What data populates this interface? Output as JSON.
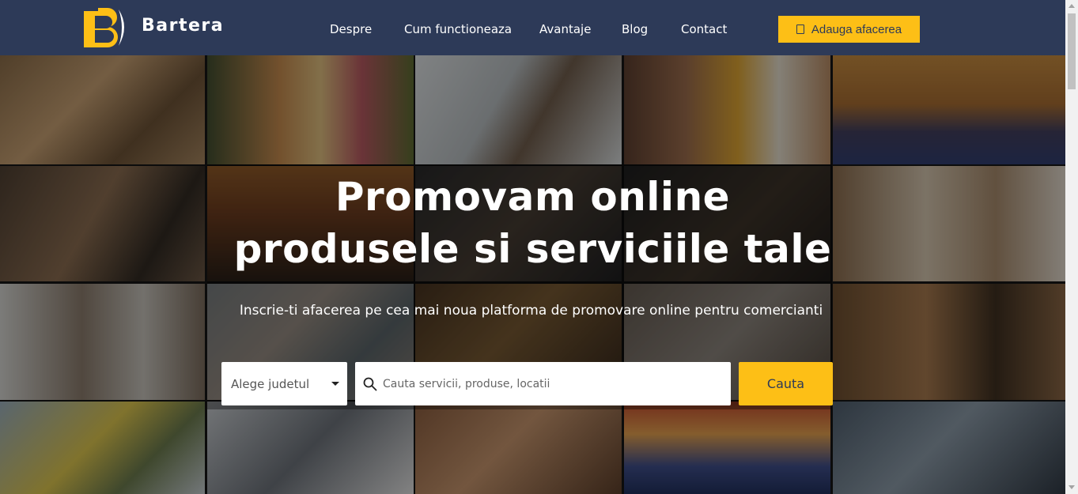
{
  "header": {
    "brand": "Bartera",
    "nav": [
      "Despre",
      "Cum functioneaza",
      "Avantaje",
      "Blog",
      "Contact"
    ],
    "add_business_label": "Adauga afacerea"
  },
  "hero": {
    "headline_line1": "Promovam online",
    "headline_line2": "produsele si serviciile tale",
    "subtitle": "Inscrie-ti afacerea pe cea mai noua platforma de promovare online pentru comercianti",
    "county_select": "Alege judetul",
    "search_placeholder": "Cauta servicii, produse, locatii",
    "search_button": "Cauta"
  },
  "colors": {
    "header_bg": "#2d3a58",
    "accent": "#fdbf16"
  },
  "icons": [
    "logo-icon",
    "plus-icon",
    "search-icon",
    "dropdown-caret-icon"
  ]
}
